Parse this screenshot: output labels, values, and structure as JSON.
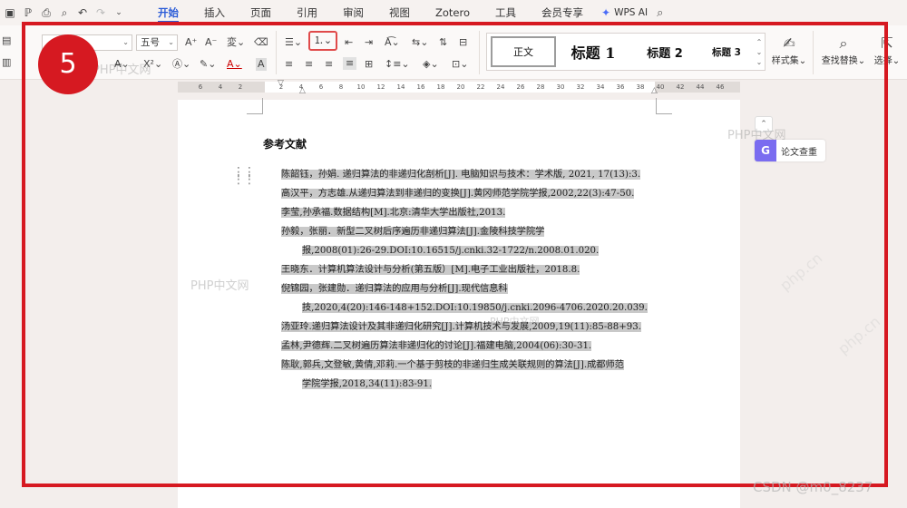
{
  "menubar": {
    "tabs": [
      "开始",
      "插入",
      "页面",
      "引用",
      "审阅",
      "视图",
      "Zotero",
      "工具",
      "会员专享"
    ],
    "wps_ai": "WPS AI"
  },
  "ribbon": {
    "font_size": "五号",
    "styles": [
      "正文",
      "标题 1",
      "标题 2",
      "标题 3"
    ],
    "style_set": "样式集",
    "find_replace": "查找替换",
    "select": "选择"
  },
  "ruler": {
    "numbers": [
      "6",
      "4",
      "2",
      "2",
      "4",
      "6",
      "8",
      "10",
      "12",
      "14",
      "16",
      "18",
      "20",
      "22",
      "24",
      "26",
      "28",
      "30",
      "32",
      "34",
      "36",
      "38",
      "40",
      "42",
      "44",
      "46"
    ]
  },
  "page": {
    "title": "参考文献",
    "references": [
      {
        "line": "陈韶钰，孙娟. 递归算法的非递归化剖析[J]. 电脑知识与技术：学术版, 2021, 17(13):3.",
        "cont": ""
      },
      {
        "line": "高汉平，方志雄.从递归算法到非递归的变换[J].黄冈师范学院学报,2002,22(3):47-50.",
        "cont": ""
      },
      {
        "line": "李莹,孙承福.数据结构[M].北京:清华大学出版社,2013.",
        "cont": ""
      },
      {
        "line": "孙毅，张丽．新型二叉树后序遍历非递归算法[J].金陵科技学院学",
        "cont": "报,2008(01):26-29.DOI:10.16515/j.cnki.32-1722/n.2008.01.020."
      },
      {
        "line": "王晓东．计算机算法设计与分析(第五版）[M].电子工业出版社，2018.8.",
        "cont": ""
      },
      {
        "line": "倪锦园，张建勋．递归算法的应用与分析[J].现代信息科",
        "cont": "技,2020,4(20):146-148+152.DOI:10.19850/j.cnki.2096-4706.2020.20.039."
      },
      {
        "line": "汤亚玲.递归算法设计及其非递归化研究[J].计算机技术与发展,2009,19(11):85-88+93.",
        "cont": ""
      },
      {
        "line": "孟林,尹德辉.二叉树遍历算法非递归化的讨论[J].福建电脑,2004(06):30-31.",
        "cont": ""
      },
      {
        "line": "陈耿,郭兵,文登敏,黄倩,邓莉.一个基于剪枝的非递归生成关联规则的算法[J].成都师范",
        "cont": "学院学报,2018,34(11):83-91."
      }
    ]
  },
  "side": {
    "paper_check": "论文查重"
  },
  "overlay": {
    "step": "5",
    "watermark_text": "PHP中文网",
    "watermark_big": "php.cn",
    "csdn": "CSDN @m0_8237"
  },
  "colors": {
    "accent": "#2a5bd7",
    "annotation_red": "#d61921",
    "selection": "#c9c9c9"
  }
}
